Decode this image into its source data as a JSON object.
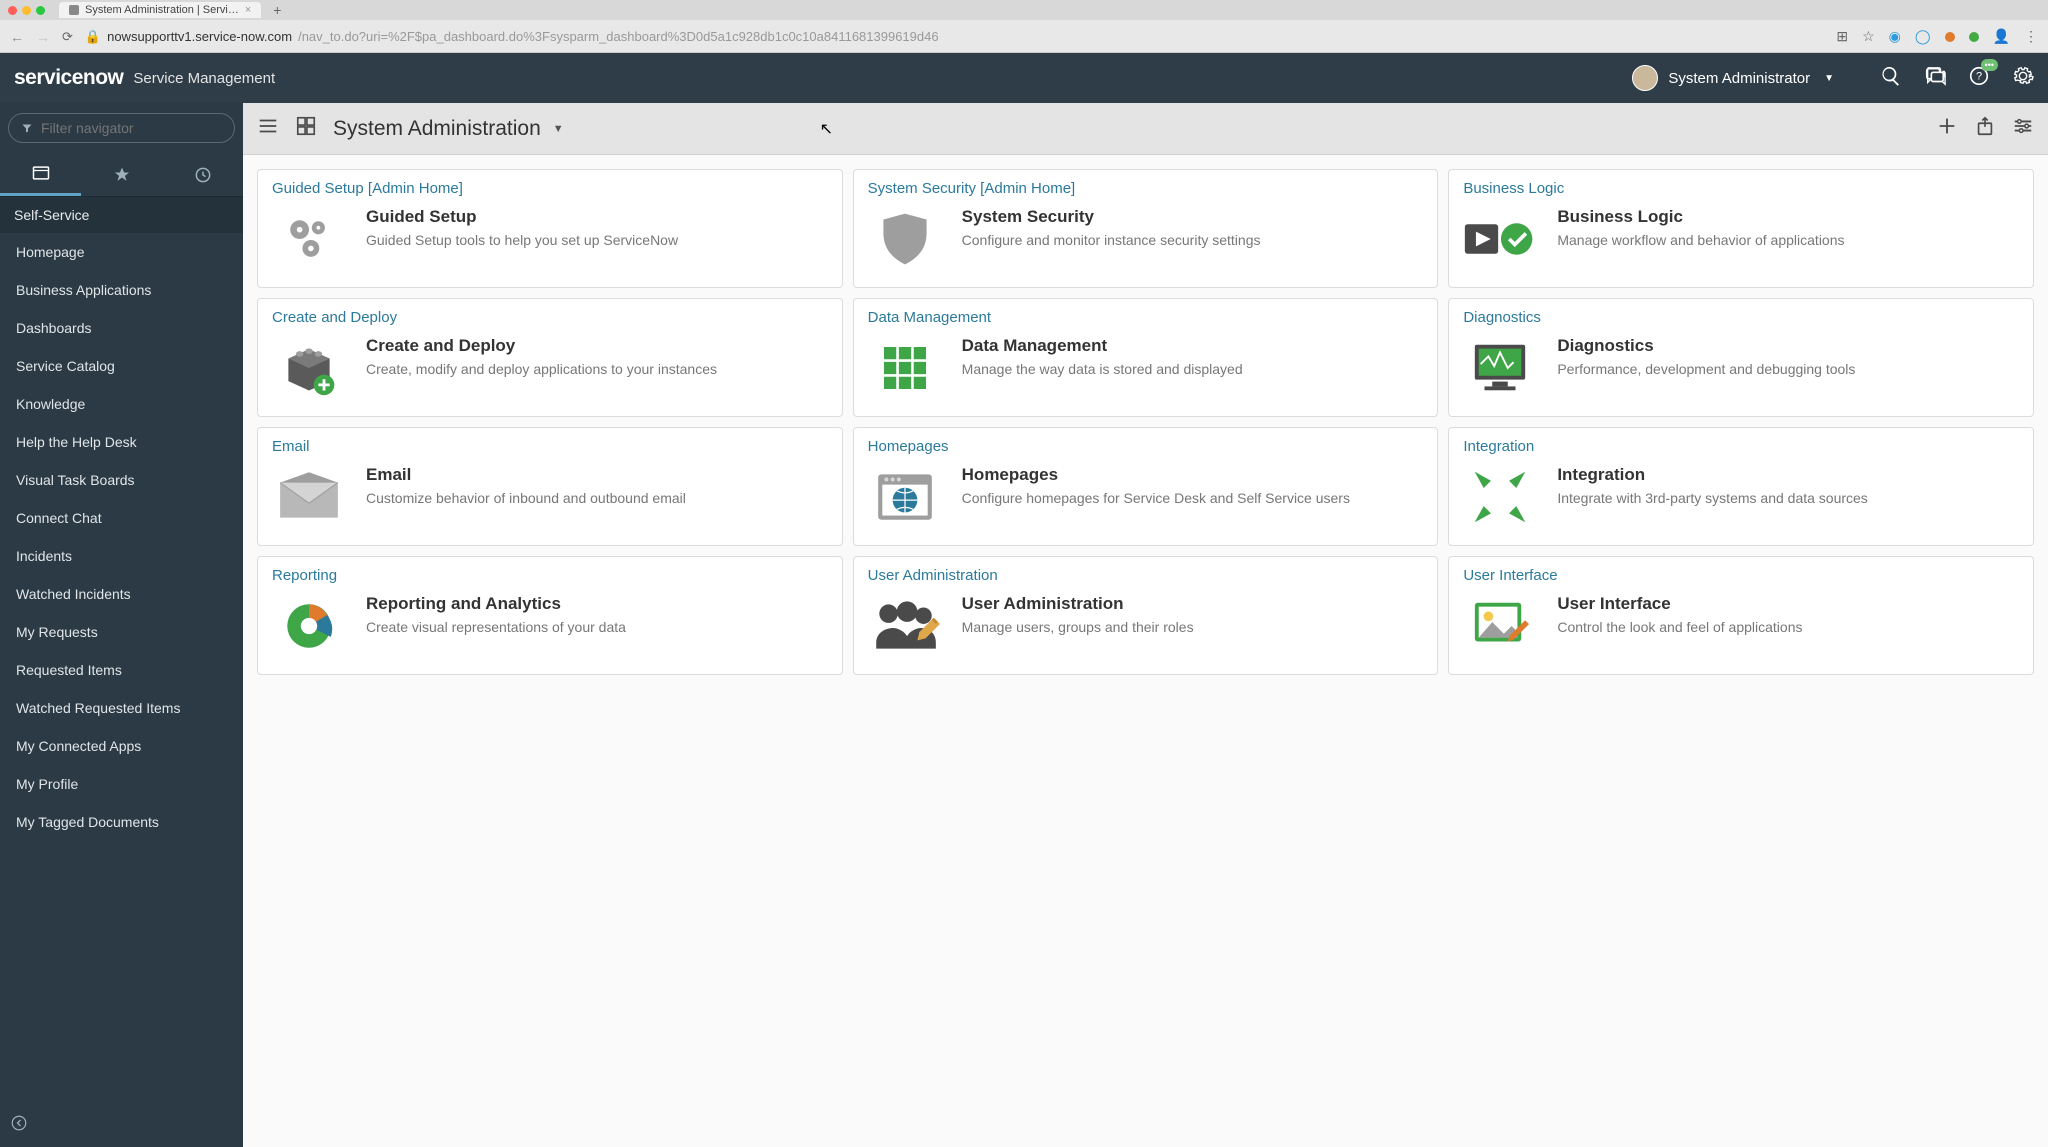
{
  "browser": {
    "tab_title": "System Administration | Servi…",
    "url_host": "nowsupporttv1.service-now.com",
    "url_path": "/nav_to.do?uri=%2F$pa_dashboard.do%3Fsysparm_dashboard%3D0d5a1c928db1c0c10a8411681399619d46"
  },
  "header": {
    "logo": "servicenow",
    "logo_sub": "Service Management",
    "user_name": "System Administrator"
  },
  "sidebar": {
    "filter_placeholder": "Filter navigator",
    "section": "Self-Service",
    "items": [
      "Homepage",
      "Business Applications",
      "Dashboards",
      "Service Catalog",
      "Knowledge",
      "Help the Help Desk",
      "Visual Task Boards",
      "Connect Chat",
      "Incidents",
      "Watched Incidents",
      "My Requests",
      "Requested Items",
      "Watched Requested Items",
      "My Connected Apps",
      "My Profile",
      "My Tagged Documents"
    ]
  },
  "toolbar": {
    "title": "System Administration"
  },
  "cards": [
    {
      "header": "Guided Setup [Admin Home]",
      "title": "Guided Setup",
      "desc": "Guided Setup tools to help you set up ServiceNow",
      "icon": "gears"
    },
    {
      "header": "System Security [Admin Home]",
      "title": "System Security",
      "desc": "Configure and monitor instance security settings",
      "icon": "shield-lock"
    },
    {
      "header": "Business Logic",
      "title": "Business Logic",
      "desc": "Manage workflow and behavior of applications",
      "icon": "play-check"
    },
    {
      "header": "Create and Deploy",
      "title": "Create and Deploy",
      "desc": "Create, modify and deploy applications to your instances",
      "icon": "box-plus"
    },
    {
      "header": "Data Management",
      "title": "Data Management",
      "desc": "Manage the way data is stored and displayed",
      "icon": "grid"
    },
    {
      "header": "Diagnostics",
      "title": "Diagnostics",
      "desc": "Performance, development and debugging tools",
      "icon": "monitor-wave"
    },
    {
      "header": "Email",
      "title": "Email",
      "desc": "Customize behavior of inbound and outbound email",
      "icon": "envelope"
    },
    {
      "header": "Homepages",
      "title": "Homepages",
      "desc": "Configure homepages for Service Desk and Self Service users",
      "icon": "browser-globe"
    },
    {
      "header": "Integration",
      "title": "Integration",
      "desc": "Integrate with 3rd-party systems and data sources",
      "icon": "arrows-in"
    },
    {
      "header": "Reporting",
      "title": "Reporting and Analytics",
      "desc": "Create visual representations of your data",
      "icon": "pie"
    },
    {
      "header": "User Administration",
      "title": "User Administration",
      "desc": "Manage users, groups and their roles",
      "icon": "users-pencil"
    },
    {
      "header": "User Interface",
      "title": "User Interface",
      "desc": "Control the look and feel of applications",
      "icon": "picture-brush"
    }
  ]
}
